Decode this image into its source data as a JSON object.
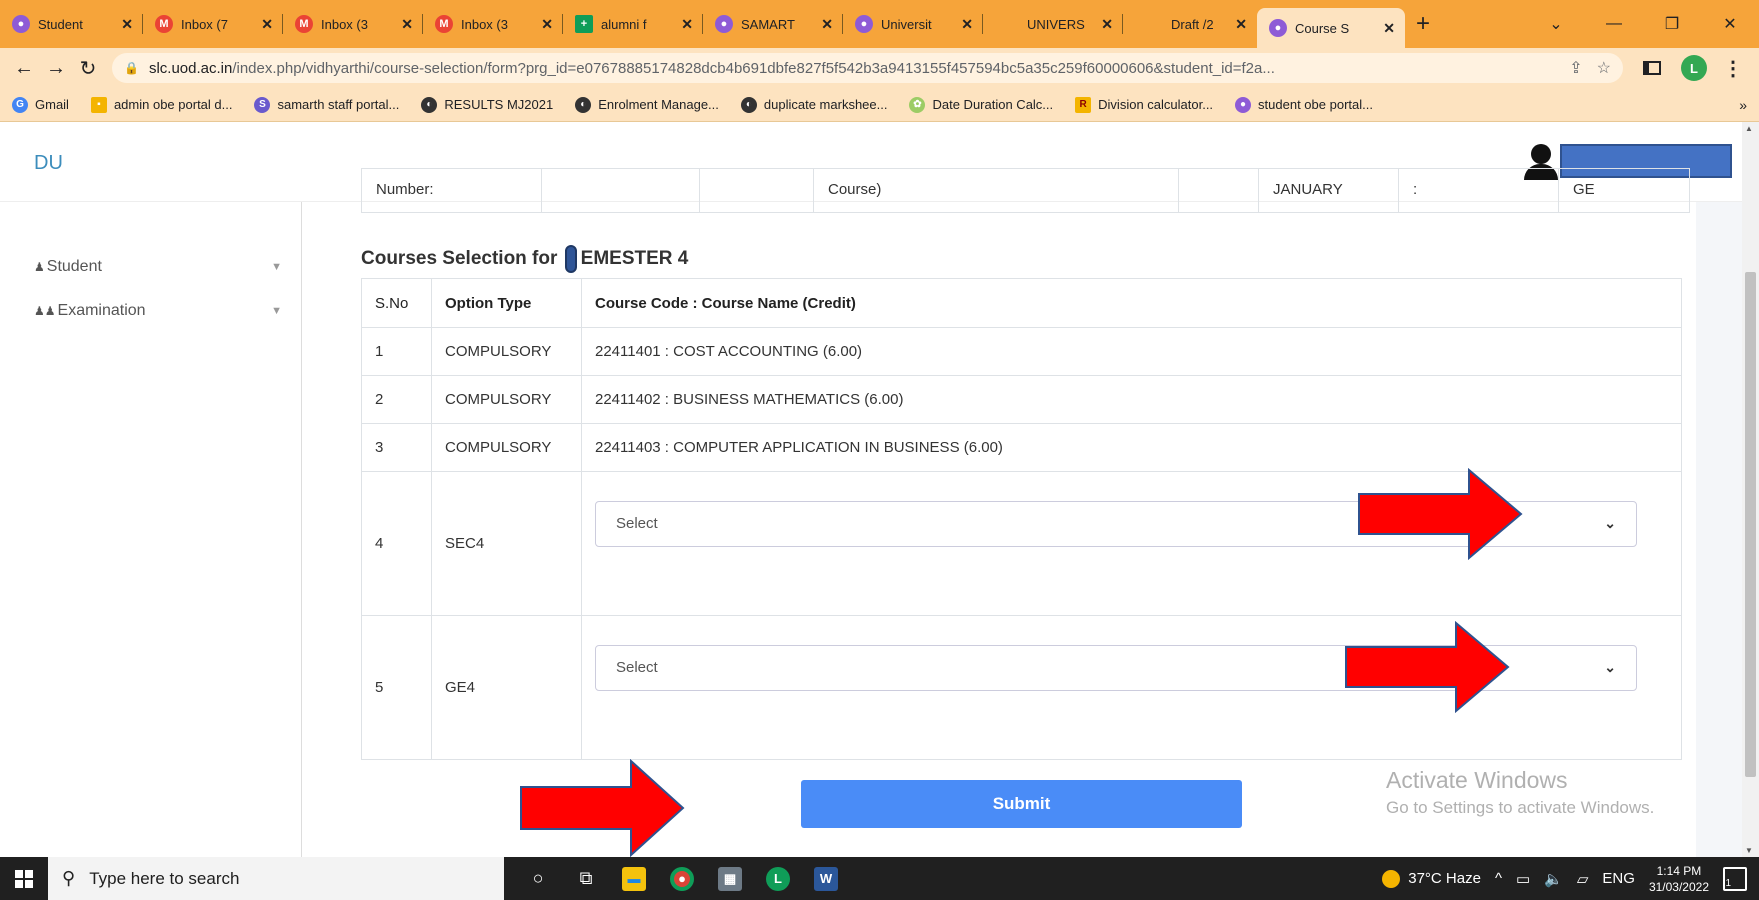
{
  "browser": {
    "tabs": [
      {
        "title": "Student",
        "icon": "samarth-icon",
        "color": "#8e5bd6",
        "active": false
      },
      {
        "title": "Inbox (7",
        "icon": "gmail-icon",
        "color": "#ea4335",
        "active": false
      },
      {
        "title": "Inbox (3",
        "icon": "gmail-icon",
        "color": "#ea4335",
        "active": false
      },
      {
        "title": "Inbox (3",
        "icon": "gmail-icon",
        "color": "#ea4335",
        "active": false
      },
      {
        "title": "alumni f",
        "icon": "sheets-icon",
        "color": "#0f9d58",
        "active": false
      },
      {
        "title": "SAMART",
        "icon": "samarth-icon",
        "color": "#8e5bd6",
        "active": false
      },
      {
        "title": "Universit",
        "icon": "samarth-icon",
        "color": "#8e5bd6",
        "active": false
      },
      {
        "title": "UNIVERS",
        "icon": "blank-icon",
        "color": "",
        "active": false
      },
      {
        "title": "Draft /2",
        "icon": "blank-icon",
        "color": "",
        "active": false
      },
      {
        "title": "Course S",
        "icon": "samarth-icon",
        "color": "#8e5bd6",
        "active": true
      }
    ],
    "new_tab": "+",
    "url_host": "slc.uod.ac.in",
    "url_rest": "/index.php/vidhyarthi/course-selection/form?prg_id=e07678885174828dcb4b691dbfe827f5f542b3a9413155f457594bc5a35c259f60000606&student_id=f2a...",
    "profile_initial": "L",
    "bookmarks": [
      {
        "label": "Gmail",
        "icon": "google-g-icon",
        "color": "#4285f4"
      },
      {
        "label": "admin obe portal d...",
        "icon": "grid-icon",
        "color": "#f4b400"
      },
      {
        "label": "samarth staff portal...",
        "icon": "samarth-s-icon",
        "color": "#6a5acd"
      },
      {
        "label": "RESULTS MJ2021",
        "icon": "globe-icon",
        "color": "#333333"
      },
      {
        "label": "Enrolment Manage...",
        "icon": "globe-icon",
        "color": "#333333"
      },
      {
        "label": "duplicate markshee...",
        "icon": "globe-icon",
        "color": "#333333"
      },
      {
        "label": "Date Duration Calc...",
        "icon": "calendar-icon",
        "color": "#9ccc65"
      },
      {
        "label": "Division calculator...",
        "icon": "r-icon",
        "color": "#f4b400"
      },
      {
        "label": "student obe portal...",
        "icon": "samarth-icon",
        "color": "#8e5bd6"
      }
    ],
    "bookmarks_more": "»"
  },
  "app": {
    "brand": "DU",
    "sidebar": [
      {
        "label": "Student",
        "icon": "user-icon"
      },
      {
        "label": "Examination",
        "icon": "users-icon"
      }
    ],
    "info_row": {
      "label": "Number:",
      "course_suffix": "Course)",
      "month": "JANUARY",
      "colon": ":",
      "code": "GE"
    },
    "section_title_prefix": "Courses Selection for",
    "section_title_suffix": "EMESTER 4",
    "table": {
      "headers": [
        "S.No",
        "Option Type",
        "Course Code : Course Name (Credit)"
      ],
      "rows": [
        {
          "sno": "1",
          "type": "COMPULSORY",
          "course": "22411401 : COST ACCOUNTING (6.00)"
        },
        {
          "sno": "2",
          "type": "COMPULSORY",
          "course": "22411402 : BUSINESS MATHEMATICS (6.00)"
        },
        {
          "sno": "3",
          "type": "COMPULSORY",
          "course": "22411403 : COMPUTER APPLICATION IN BUSINESS (6.00)"
        }
      ],
      "select_rows": [
        {
          "sno": "4",
          "type": "SEC4",
          "selected": "Select"
        },
        {
          "sno": "5",
          "type": "GE4",
          "selected": "Select"
        }
      ]
    },
    "submit_label": "Submit",
    "watermark_line1": "Activate Windows",
    "watermark_line2": "Go to Settings to activate Windows."
  },
  "taskbar": {
    "search_placeholder": "Type here to search",
    "weather": "37°C  Haze",
    "language": "ENG",
    "time": "1:14 PM",
    "date": "31/03/2022",
    "notification_count": "1"
  },
  "colors": {
    "tabstrip": "#f6a43a",
    "toolbar": "#fde3c0",
    "submit": "#4a8cf7",
    "annotation_arrow": "#ff0000",
    "brand": "#3c8dbc"
  }
}
